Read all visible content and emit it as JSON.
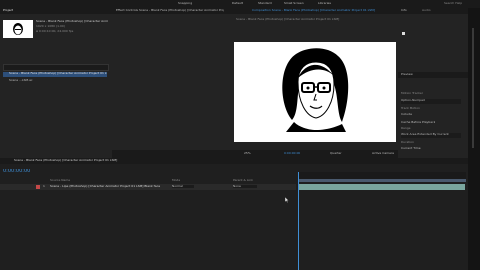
{
  "menu": {
    "tool_labels": [
      "Snapping",
      "Default",
      "Standard",
      "Small Screen",
      "Libraries"
    ],
    "search_placeholder": "Search Help"
  },
  "project": {
    "tab": "Project",
    "asset_name": "Scene - Blank Face (Photoshop) [Character Animator Project 01 LSM]",
    "asset_info_1": "1920 x 1080 (1.00)",
    "asset_info_2": "Δ 0:00:10:00, 24.000 fps",
    "search_placeholder": "",
    "items": [
      "Scene - Blank Face (Photoshop) [Character Animator Project 01 LSM]",
      "Scene ...LSM.ac"
    ]
  },
  "comp_tabs": [
    "Effect Controls Scene - Blank Face (Photoshop) [Character Animator Project 01 LSM]",
    "Composition Scene - Blank Face (Photoshop) [Character Animator Project 01 LSM]"
  ],
  "comp_breadcrumb": "Scene - Blank Face (Photoshop) [Character Animator Project 01 LSM]",
  "viewer": {
    "zoom": "25%",
    "timecode": "0:00:00:00",
    "resolution": "Quarter",
    "camera": "Active Camera"
  },
  "right_panel": {
    "info_tab": "Info",
    "audio_tab": "Audio",
    "preview_tab": "Preview",
    "tracker_tab": "Tracker",
    "brush_tab": "Brushes",
    "sections": [
      "Motion Tracker",
      "Track Motion",
      "Track Type",
      "Range",
      "Duration",
      "Current Time"
    ],
    "options": [
      "Option-Numpad",
      "Include",
      "Cache Before Playback",
      "Work Area Extended By Current",
      "Current Time"
    ]
  },
  "timeline": {
    "tab": "Scene - Blank Face (Photoshop) [Character Animator Project 01 LSM]",
    "timecode": "0:00:00:00",
    "layer_num": "1",
    "layer_name": "Scene - Lipe (Photoshop) [Character Animator Project 01 LSM] Blank face",
    "mode": "Normal",
    "parent": "None",
    "source_header": "Source Name",
    "mode_header": "Mode",
    "parent_header": "Parent & Link"
  },
  "colors": {
    "accent_blue": "#3f8fd6",
    "track_teal": "#7aa69e",
    "playhead_blue": "#3f8fd6",
    "layer_label_red": "#c44848"
  }
}
